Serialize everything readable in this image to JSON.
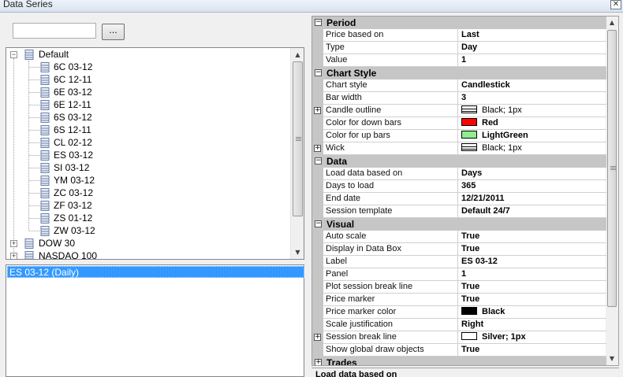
{
  "window": {
    "title": "Data Series",
    "close_glyph": "✕"
  },
  "search": {
    "value": "",
    "browse_label": "..."
  },
  "tree": {
    "root": {
      "label": "Default",
      "expander": "−"
    },
    "children": [
      "6C 03-12",
      "6C 12-11",
      "6E 03-12",
      "6E 12-11",
      "6S 03-12",
      "6S 12-11",
      "CL 02-12",
      "ES 03-12",
      "SI 03-12",
      "YM 03-12",
      "ZC 03-12",
      "ZF 03-12",
      "ZS 01-12",
      "ZW 03-12"
    ],
    "groups": [
      {
        "label": "DOW 30",
        "expander": "+"
      },
      {
        "label": "NASDAQ 100",
        "expander": "+"
      }
    ]
  },
  "selected_series": [
    "ES 03-12 (Daily)"
  ],
  "properties": {
    "categories": [
      {
        "label": "Period",
        "toggle": "−",
        "rows": [
          {
            "name": "Price based on",
            "value": "Last"
          },
          {
            "name": "Type",
            "value": "Day"
          },
          {
            "name": "Value",
            "value": "1"
          }
        ]
      },
      {
        "label": "Chart Style",
        "toggle": "−",
        "rows": [
          {
            "name": "Chart style",
            "value": "Candlestick"
          },
          {
            "name": "Bar width",
            "value": "3"
          },
          {
            "name": "Candle outline",
            "value": "Black; 1px",
            "swatch": "lines",
            "expandable": true,
            "plain": true
          },
          {
            "name": "Color for down bars",
            "value": "Red",
            "swatch": "#ff0000"
          },
          {
            "name": "Color for up bars",
            "value": "LightGreen",
            "swatch": "#90ee90"
          },
          {
            "name": "Wick",
            "value": "Black; 1px",
            "swatch": "lines",
            "expandable": true,
            "plain": true
          }
        ]
      },
      {
        "label": "Data",
        "toggle": "−",
        "rows": [
          {
            "name": "Load data based on",
            "value": "Days"
          },
          {
            "name": "Days to load",
            "value": "365"
          },
          {
            "name": "End date",
            "value": "12/21/2011"
          },
          {
            "name": "Session template",
            "value": "Default 24/7"
          }
        ]
      },
      {
        "label": "Visual",
        "toggle": "−",
        "rows": [
          {
            "name": "Auto scale",
            "value": "True"
          },
          {
            "name": "Display in Data Box",
            "value": "True"
          },
          {
            "name": "Label",
            "value": "ES 03-12"
          },
          {
            "name": "Panel",
            "value": "1"
          },
          {
            "name": "Plot session break line",
            "value": "True"
          },
          {
            "name": "Price marker",
            "value": "True"
          },
          {
            "name": "Price marker color",
            "value": "Black",
            "swatch": "#000000"
          },
          {
            "name": "Scale justification",
            "value": "Right"
          },
          {
            "name": "Session break line",
            "value": "Silver; 1px",
            "swatch": "#ffffff",
            "expandable": true
          },
          {
            "name": "Show global draw objects",
            "value": "True"
          }
        ]
      },
      {
        "label": "Trades",
        "toggle": "+",
        "rows": []
      }
    ]
  },
  "description": {
    "title": "Load data based on"
  },
  "icons": {
    "tree_node": "database-icon",
    "scroll_up": "▲",
    "scroll_down": "▼"
  }
}
